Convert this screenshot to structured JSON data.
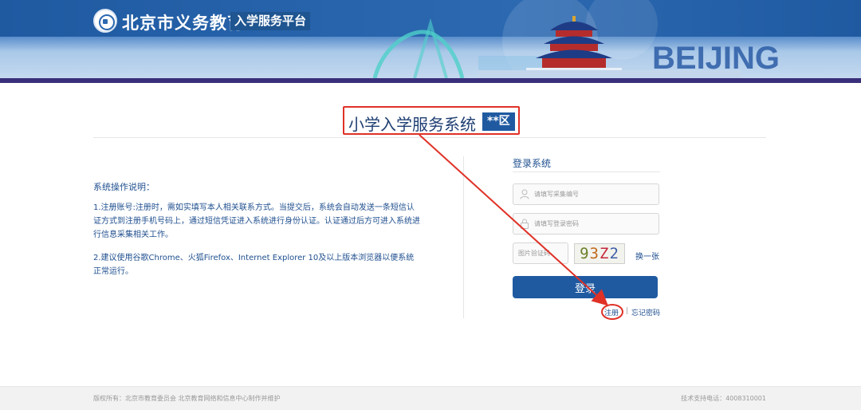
{
  "header": {
    "brand": "北京市义务教育",
    "brand_sub": "入学服务平台",
    "banner_text": "BEIJING"
  },
  "main": {
    "system_title": "小学入学服务系统",
    "district": "**区"
  },
  "instructions": {
    "title": "系统操作说明：",
    "items": [
      "1.注册账号:注册时，需如实填写本人相关联系方式。当提交后，系统会自动发送一条短信认证方式到注册手机号码上，通过短信凭证进入系统进行身份认证。认证通过后方可进入系统进行信息采集相关工作。",
      "2.建议使用谷歌Chrome、火狐Firefox、Internet Explorer 10及以上版本浏览器以便系统正常运行。"
    ]
  },
  "login": {
    "title": "登录系统",
    "account_placeholder": "请填写采集编号",
    "password_placeholder": "请填写登录密码",
    "captcha_placeholder": "图片验证码",
    "captcha_chars": [
      "9",
      "3",
      "Z",
      "2"
    ],
    "refresh_label": "换一张",
    "login_label": "登录",
    "register_label": "注册",
    "separator": "|",
    "forgot_label": "忘记密码"
  },
  "footer": {
    "copyright": "版权所有：北京市教育委员会 北京教育网络和信息中心制作并维护",
    "support": "技术支持电话：4008310001"
  },
  "colors": {
    "primary": "#1f5aa1",
    "annotation": "#e03127"
  }
}
